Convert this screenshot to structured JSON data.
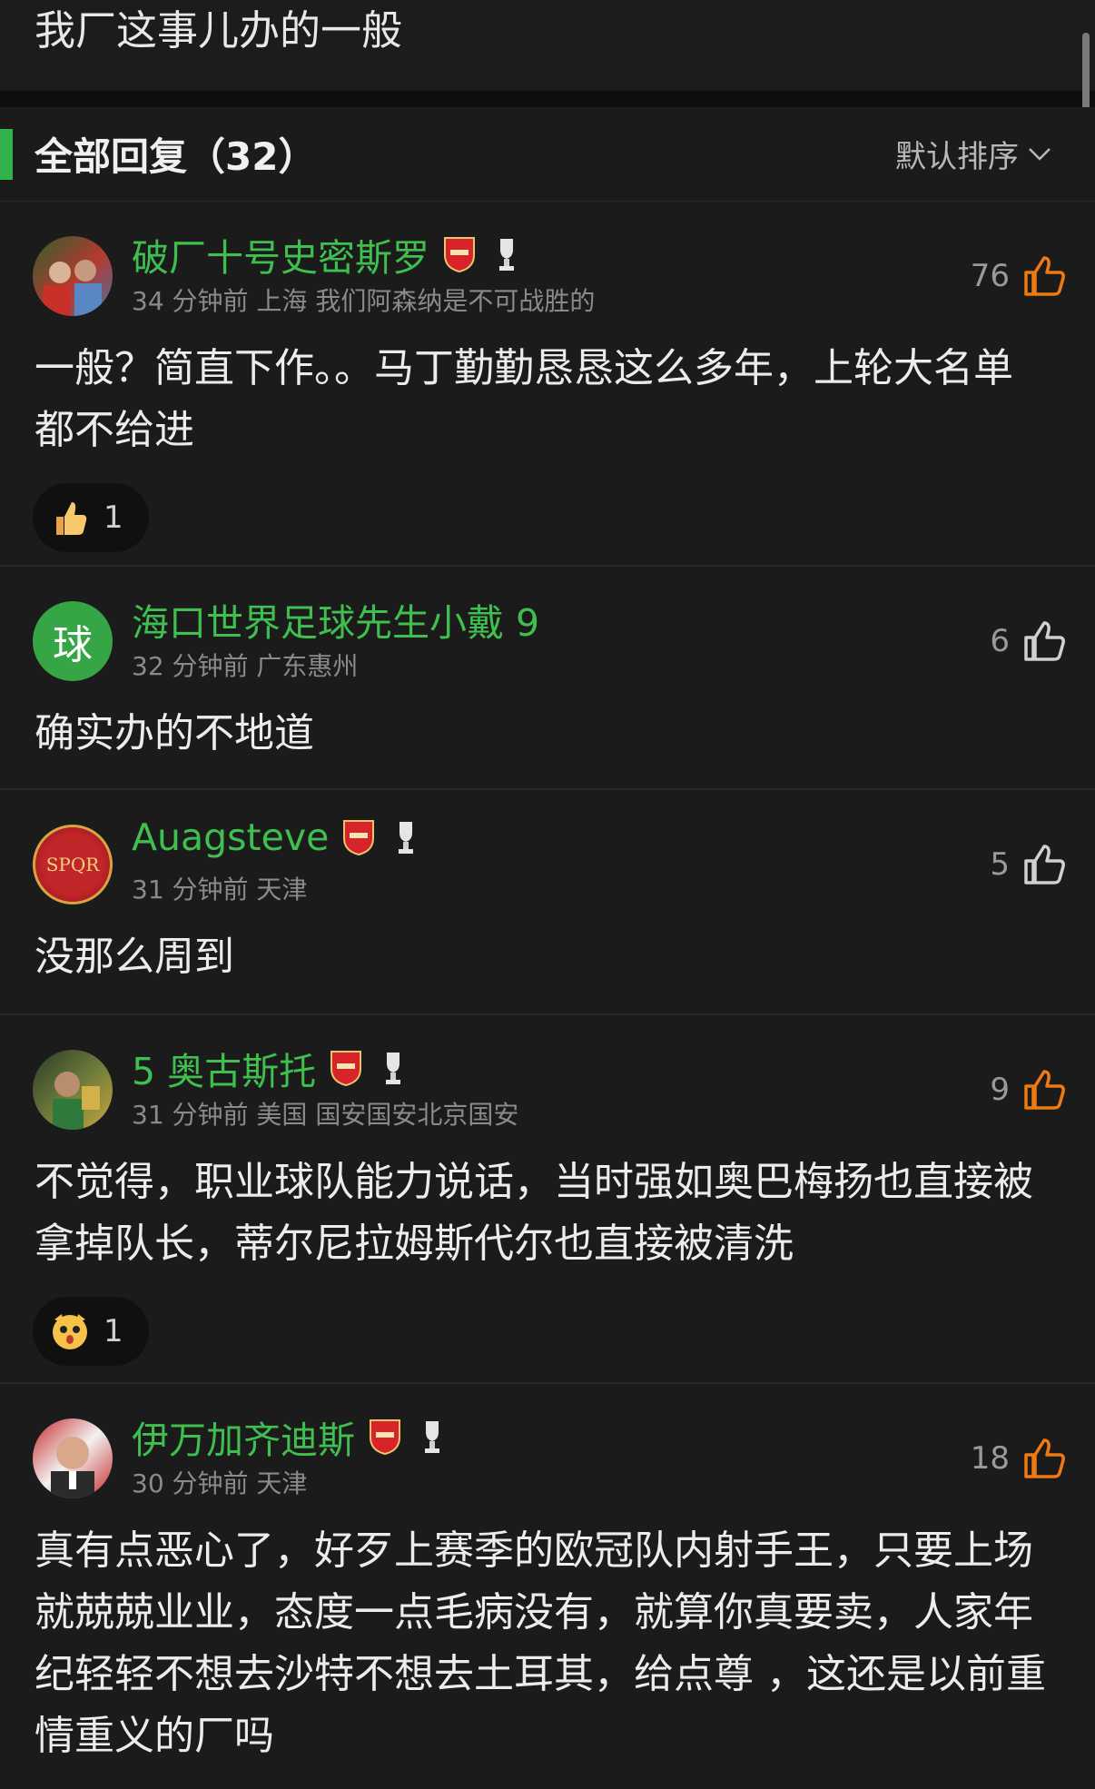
{
  "post": {
    "text": "我厂这事儿办的一般"
  },
  "header": {
    "title": "全部回复（32）",
    "sort_label": "默认排序"
  },
  "colors": {
    "accent": "#2fb34a",
    "username": "#3fbf4f",
    "like_active": "#f07a12",
    "like_inactive": "#d0d0d0"
  },
  "comments": [
    {
      "username": "破厂十号史密斯罗",
      "meta": "34 分钟前  上海  我们阿森纳是不可战胜的",
      "likes": "76",
      "liked": true,
      "text": "一般？简直下作。。马丁勤勤恳恳这么多年，上轮大名单都不给进",
      "reaction": {
        "icon": "thumbs-up-emoji",
        "count": "1"
      }
    },
    {
      "username": "海口世界足球先生小戴 9",
      "avatar_char": "球",
      "meta": "32 分钟前  广东惠州",
      "likes": "6",
      "liked": false,
      "text": "确实办的不地道"
    },
    {
      "username": "Auagsteve",
      "avatar_text": "SPQR",
      "meta": "31 分钟前  天津",
      "likes": "5",
      "liked": false,
      "text": "没那么周到"
    },
    {
      "username": "5 奥古斯托",
      "meta": "31 分钟前  美国  国安国安北京国安",
      "likes": "9",
      "liked": true,
      "text": "不觉得，职业球队能力说话，当时强如奥巴梅扬也直接被拿掉队长，蒂尔尼拉姆斯代尔也直接被清洗",
      "reaction": {
        "icon": "surprised-emoji",
        "count": "1"
      }
    },
    {
      "username": "伊万加齐迪斯",
      "meta": "30 分钟前  天津",
      "likes": "18",
      "liked": true,
      "text": "真有点恶心了，好歹上赛季的欧冠队内射手王，只要上场就兢兢业业，态度一点毛病没有，就算你真要卖，人家年纪轻轻不想去沙特不想去土耳其，给点尊        ，这还是以前重情重义的厂吗"
    }
  ]
}
